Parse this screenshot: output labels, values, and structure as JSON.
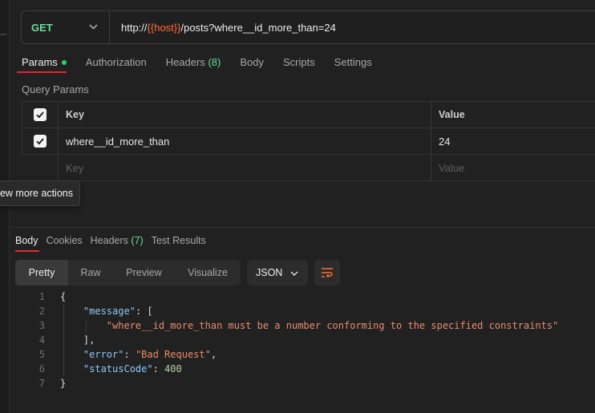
{
  "request": {
    "method": "GET",
    "url_prefix": "http://",
    "url_variable": "{{host}}",
    "url_suffix": "/posts?where__id_more_than=24"
  },
  "request_tabs": [
    {
      "label": "Params"
    },
    {
      "label": "Authorization"
    },
    {
      "label": "Headers",
      "count": "(8)"
    },
    {
      "label": "Body"
    },
    {
      "label": "Scripts"
    },
    {
      "label": "Settings"
    }
  ],
  "query_params": {
    "title": "Query Params",
    "columns": {
      "key": "Key",
      "value": "Value"
    },
    "rows": [
      {
        "key": "where__id_more_than",
        "value": "24",
        "checked": true
      }
    ],
    "placeholder": {
      "key": "Key",
      "value": "Value"
    }
  },
  "tooltip": "View more actions",
  "response_tabs": [
    {
      "label": "Body"
    },
    {
      "label": "Cookies"
    },
    {
      "label": "Headers",
      "count": "(7)"
    },
    {
      "label": "Test Results"
    }
  ],
  "format": {
    "modes": [
      "Pretty",
      "Raw",
      "Preview",
      "Visualize"
    ],
    "selected_mode": "Pretty",
    "language": "JSON"
  },
  "response_body": {
    "line_numbers": [
      "1",
      "2",
      "3",
      "4",
      "5",
      "6",
      "7"
    ],
    "open_brace": "{",
    "close_brace": "}",
    "message_key": "\"message\"",
    "message_open": ": [",
    "message_value": "\"where__id_more_than must be a number conforming to the specified constraints\"",
    "message_close": "],",
    "error_key": "\"error\"",
    "error_value": "\"Bad Request\"",
    "status_key": "\"statusCode\"",
    "status_value": "400"
  },
  "colors": {
    "accent_red": "#e8232c",
    "method_green": "#6bdd9a",
    "variable_orange": "#ff6c37",
    "json_key": "#8fc6f5",
    "json_string": "#e98b6a"
  }
}
